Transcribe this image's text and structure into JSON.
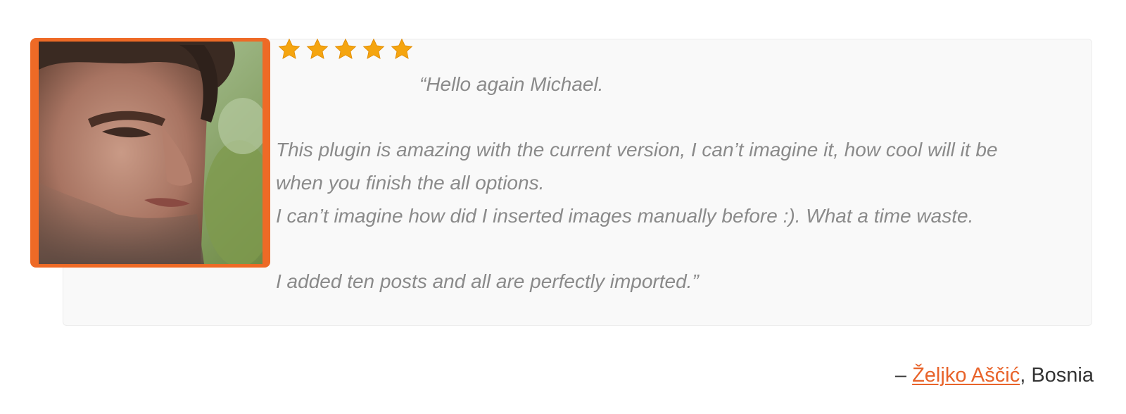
{
  "testimonial": {
    "rating": 5,
    "star_color": "#f5a510",
    "quote_lines": [
      "“Hello again Michael.",
      "This plugin is amazing with the current version, I can’t imagine it, how cool will it be",
      "when you finish the all options.",
      "I can’t imagine how did I inserted images manually before :). What a time waste.",
      "I added ten posts and all are perfectly imported.”"
    ]
  },
  "author": {
    "dash": "– ",
    "name": "Željko Aščić",
    "location": ", Bosnia",
    "link_color": "#e8632a"
  },
  "avatar": {
    "frame_color": "#ee6a26",
    "icon": "person-photo"
  }
}
